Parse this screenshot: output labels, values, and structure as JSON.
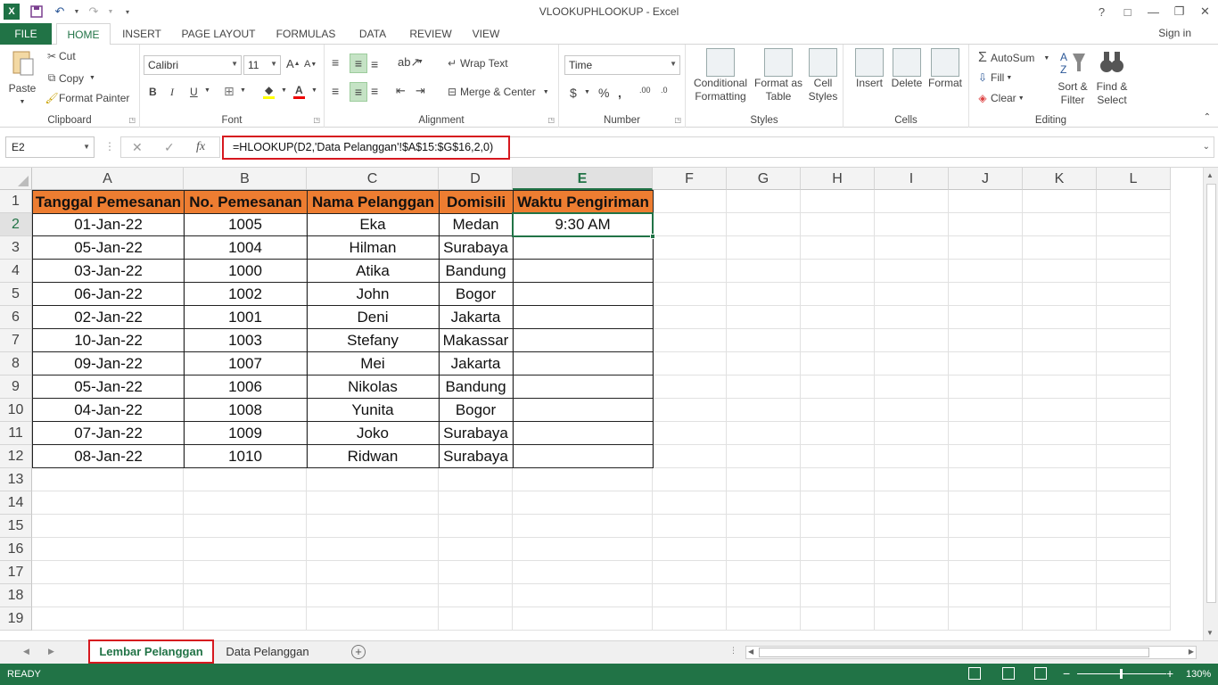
{
  "window": {
    "title": "VLOOKUPHLOOKUP - Excel",
    "controls": [
      "?",
      "□",
      "—",
      "❐",
      "✕"
    ]
  },
  "ribbon_tabs": [
    "FILE",
    "HOME",
    "INSERT",
    "PAGE LAYOUT",
    "FORMULAS",
    "DATA",
    "REVIEW",
    "VIEW"
  ],
  "signin": "Sign in",
  "clipboard": {
    "paste": "Paste",
    "cut": "Cut",
    "copy": "Copy",
    "format_painter": "Format Painter",
    "label": "Clipboard"
  },
  "font": {
    "name": "Calibri",
    "size": "11",
    "label": "Font"
  },
  "alignment": {
    "wrap_text": "Wrap Text",
    "merge_center": "Merge & Center",
    "label": "Alignment"
  },
  "number": {
    "format": "Time",
    "label": "Number"
  },
  "styles": {
    "conditional_1": "Conditional",
    "conditional_2": "Formatting",
    "format_table_1": "Format as",
    "format_table_2": "Table",
    "cell_styles_1": "Cell",
    "cell_styles_2": "Styles",
    "label": "Styles"
  },
  "cells": {
    "insert": "Insert",
    "delete": "Delete",
    "format": "Format",
    "label": "Cells"
  },
  "editing": {
    "autosum": "AutoSum",
    "fill": "Fill",
    "clear": "Clear",
    "sort_1": "Sort &",
    "sort_2": "Filter",
    "find_1": "Find &",
    "find_2": "Select",
    "label": "Editing"
  },
  "formula_bar": {
    "name_box": "E2",
    "formula": "=HLOOKUP(D2,'Data Pelanggan'!$A$15:$G$16,2,0)"
  },
  "columns": [
    "A",
    "B",
    "C",
    "D",
    "E",
    "F",
    "G",
    "H",
    "I",
    "J",
    "K",
    "L"
  ],
  "rows": [
    "1",
    "2",
    "3",
    "4",
    "5",
    "6",
    "7",
    "8",
    "9",
    "10",
    "11",
    "12",
    "13",
    "14",
    "15",
    "16",
    "17",
    "18",
    "19"
  ],
  "table": {
    "headers": [
      "Tanggal Pemesanan",
      "No. Pemesanan",
      "Nama Pelanggan",
      "Domisili",
      "Waktu Pengiriman"
    ],
    "rows": [
      [
        "01-Jan-22",
        "1005",
        "Eka",
        "Medan",
        "9:30 AM"
      ],
      [
        "05-Jan-22",
        "1004",
        "Hilman",
        "Surabaya",
        ""
      ],
      [
        "03-Jan-22",
        "1000",
        "Atika",
        "Bandung",
        ""
      ],
      [
        "06-Jan-22",
        "1002",
        "John",
        "Bogor",
        ""
      ],
      [
        "02-Jan-22",
        "1001",
        "Deni",
        "Jakarta",
        ""
      ],
      [
        "10-Jan-22",
        "1003",
        "Stefany",
        "Makassar",
        ""
      ],
      [
        "09-Jan-22",
        "1007",
        "Mei",
        "Jakarta",
        ""
      ],
      [
        "05-Jan-22",
        "1006",
        "Nikolas",
        "Bandung",
        ""
      ],
      [
        "04-Jan-22",
        "1008",
        "Yunita",
        "Bogor",
        ""
      ],
      [
        "07-Jan-22",
        "1009",
        "Joko",
        "Surabaya",
        ""
      ],
      [
        "08-Jan-22",
        "1010",
        "Ridwan",
        "Surabaya",
        ""
      ]
    ]
  },
  "sheet_tabs": [
    "Lembar Pelanggan",
    "Data Pelanggan"
  ],
  "status": {
    "mode": "READY",
    "zoom": "130%"
  },
  "colors": {
    "header_fill": "#ed7d31",
    "excel_green": "#217346",
    "highlight_red": "#d6181f"
  }
}
